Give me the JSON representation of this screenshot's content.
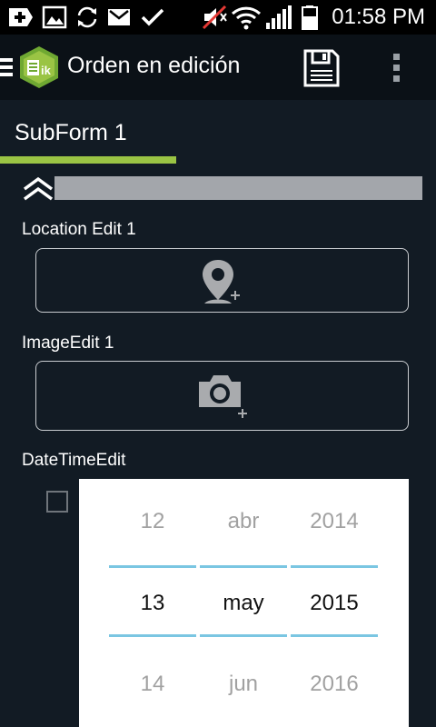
{
  "status_bar": {
    "time": "01:58 PM",
    "icons": [
      "add-box-icon",
      "image-icon",
      "sync-icon",
      "mail-icon",
      "check-icon",
      "mute-icon",
      "wifi-icon",
      "signal-icon",
      "battery-icon"
    ]
  },
  "action_bar": {
    "title": "Orden en edición",
    "icons": [
      "menu-icon",
      "app-logo-icon",
      "save-icon",
      "overflow-menu-icon"
    ]
  },
  "tabs": [
    {
      "label": "SubForm 1",
      "selected": true
    }
  ],
  "section": {
    "collapse_icon": "double-chevron-up-icon"
  },
  "fields": {
    "location": {
      "label": "Location Edit 1",
      "icon": "add-location-icon"
    },
    "image": {
      "label": "ImageEdit 1",
      "icon": "add-camera-icon"
    },
    "datetime": {
      "label": "DateTimeEdit",
      "checked": false
    }
  },
  "date_picker": {
    "day": {
      "prev": "12",
      "selected": "13",
      "next": "14"
    },
    "month": {
      "prev": "abr",
      "selected": "may",
      "next": "jun"
    },
    "year": {
      "prev": "2014",
      "selected": "2015",
      "next": "2016"
    }
  },
  "colors": {
    "background": "#121b24",
    "accent": "#9ac444",
    "picker_divider": "#7ac6e2"
  }
}
